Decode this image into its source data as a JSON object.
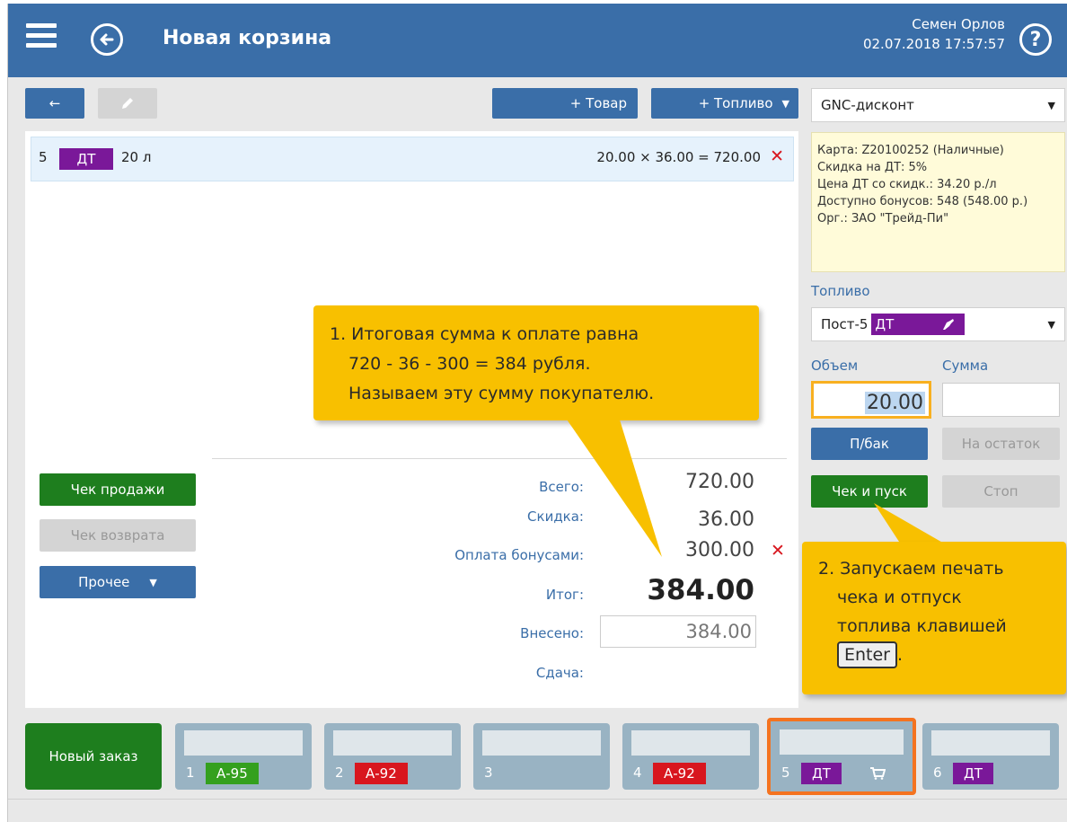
{
  "header": {
    "title": "Новая корзина",
    "user": "Семен Орлов",
    "datetime": "02.07.2018 17:57:57",
    "back_icon": "arrow-left-circle-icon",
    "menu_icon": "hamburger-icon",
    "help_icon": "question-circle-icon"
  },
  "toolbar": {
    "back_label": "←",
    "add_item_label": "+ Товар",
    "add_fuel_label": "+ Топливо"
  },
  "cart": {
    "items": [
      {
        "number": "5",
        "fuel": "ДТ",
        "volume": "20 л",
        "calc": "20.00 × 36.00 = 720.00",
        "remove": "✕"
      }
    ]
  },
  "totals": {
    "total_label": "Всего:",
    "total_value": "720.00",
    "discount_label": "Скидка:",
    "discount_value": "36.00",
    "bonus_label": "Оплата бонусами:",
    "bonus_value": "300.00",
    "bonus_remove": "✕",
    "result_label": "Итог:",
    "result_value": "384.00",
    "paid_label": "Внесено:",
    "paid_value": "384.00",
    "change_label": "Сдача:"
  },
  "actions": {
    "sale_receipt": "Чек продажи",
    "return_receipt": "Чек возврата",
    "other": "Прочее"
  },
  "right_panel": {
    "discount_program": "GNC-дисконт",
    "card_info": [
      "Карта: Z20100252 (Наличные)",
      "Скидка на ДТ: 5%",
      "Цена ДТ со скидк.: 34.20 р./л",
      "Доступно бонусов: 548 (548.00 р.)",
      "Орг.: ЗАО \"Трейд-Пи\""
    ],
    "fuel_label": "Топливо",
    "pump": "Пост-5",
    "pump_fuel": "ДТ",
    "volume_label": "Объем",
    "amount_label": "Сумма",
    "volume_value": "20.00",
    "amount_value": "",
    "full_tank": "П/бак",
    "remainder": "На остаток",
    "print_start": "Чек и пуск",
    "stop": "Стоп"
  },
  "callouts": {
    "first": [
      "1. Итоговая сумма к оплате равна",
      "720 - 36 - 300 = 384 рубля.",
      "Называем эту сумму покупателю."
    ],
    "second_lines": [
      "2. Запускаем печать",
      "чека и отпуск",
      "топлива клавишей"
    ],
    "second_key": "Enter",
    "second_end": "."
  },
  "orders": {
    "new_order": "Новый заказ",
    "tabs": [
      {
        "num": "1",
        "fuel": "А-95",
        "color": "#34a01e"
      },
      {
        "num": "2",
        "fuel": "А-92",
        "color": "#d8161e"
      },
      {
        "num": "3",
        "fuel": "",
        "color": ""
      },
      {
        "num": "4",
        "fuel": "А-92",
        "color": "#d8161e"
      },
      {
        "num": "5",
        "fuel": "ДТ",
        "color": "#7a1899"
      },
      {
        "num": "6",
        "fuel": "ДТ",
        "color": "#7a1899"
      }
    ]
  },
  "colors": {
    "header": "#3a6ea8",
    "green": "#1e7e1e",
    "callout": "#f8c000",
    "active_tab_border": "#f47320"
  }
}
